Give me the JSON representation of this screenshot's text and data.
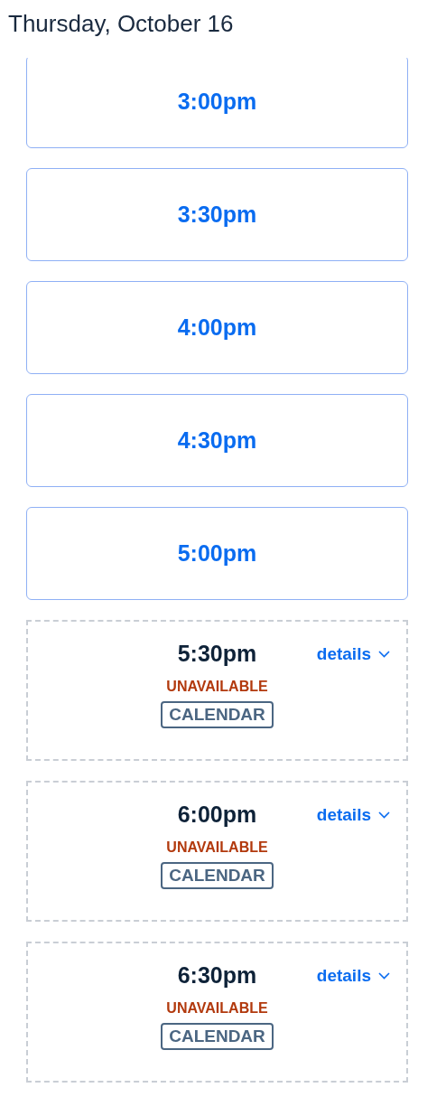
{
  "date_heading": "Thursday, October 16",
  "slots": [
    {
      "kind": "available",
      "time": "3:00pm"
    },
    {
      "kind": "available",
      "time": "3:30pm"
    },
    {
      "kind": "available",
      "time": "4:00pm"
    },
    {
      "kind": "available",
      "time": "4:30pm"
    },
    {
      "kind": "available",
      "time": "5:00pm"
    },
    {
      "kind": "unavailable",
      "time": "5:30pm",
      "details": "details",
      "status": "UNAVAILABLE",
      "tag": "CALENDAR"
    },
    {
      "kind": "unavailable",
      "time": "6:00pm",
      "details": "details",
      "status": "UNAVAILABLE",
      "tag": "CALENDAR"
    },
    {
      "kind": "unavailable",
      "time": "6:30pm",
      "details": "details",
      "status": "UNAVAILABLE",
      "tag": "CALENDAR"
    }
  ]
}
